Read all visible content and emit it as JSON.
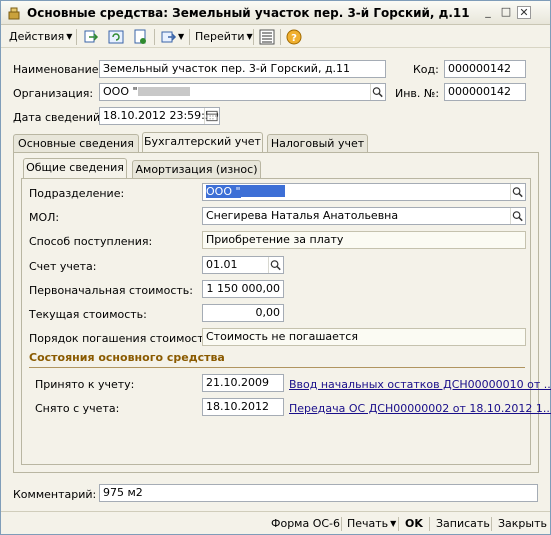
{
  "window": {
    "title": "Основные средства: Земельный участок пер. 3-й Горский, д.11"
  },
  "toolbar": {
    "actions_label": "Действия",
    "goto_label": "Перейти"
  },
  "header": {
    "name_label": "Наименование:",
    "name_value": "Земельный участок пер. 3-й Горский, д.11",
    "code_label": "Код:",
    "code_value": "000000142",
    "org_label": "Организация:",
    "org_value": "ООО \"",
    "inv_label": "Инв. №:",
    "inv_value": "000000142",
    "date_label": "Дата сведений:",
    "date_value": "18.10.2012 23:59:59"
  },
  "tabs": [
    "Основные сведения",
    "Бухгалтерский учет",
    "Налоговый учет"
  ],
  "subtabs": [
    "Общие сведения",
    "Амортизация (износ)"
  ],
  "accounting": {
    "division_label": "Подразделение:",
    "division_value": "ООО \"",
    "mol_label": "МОЛ:",
    "mol_value": "Снегирева Наталья Анатольевна",
    "receipt_label": "Способ поступления:",
    "receipt_value": "Приобретение за плату",
    "account_label": "Счет учета:",
    "account_value": "01.01",
    "initial_cost_label": "Первоначальная стоимость:",
    "initial_cost_value": "1 150 000,00",
    "current_cost_label": "Текущая стоимость:",
    "current_cost_value": "0,00",
    "repayment_label": "Порядок погашения стоимости:",
    "repayment_value": "Стоимость не погашается"
  },
  "states": {
    "title": "Состояния основного средства",
    "accepted_label": "Принято к учету:",
    "accepted_date": "21.10.2009",
    "accepted_doc": "Ввод начальных остатков ДСН00000010 от ...",
    "removed_label": "Снято с учета:",
    "removed_date": "18.10.2012",
    "removed_doc": "Передача ОС ДСН00000002 от 18.10.2012 1..."
  },
  "comment": {
    "label": "Комментарий:",
    "value": "975 м2"
  },
  "statusbar": {
    "form_os6": "Форма ОС-6",
    "print": "Печать",
    "ok": "OK",
    "save": "Записать",
    "close": "Закрыть"
  },
  "colors": {
    "link": "#1a0f8a",
    "section": "#8a5a00",
    "highlight": "#3d6fd6"
  }
}
